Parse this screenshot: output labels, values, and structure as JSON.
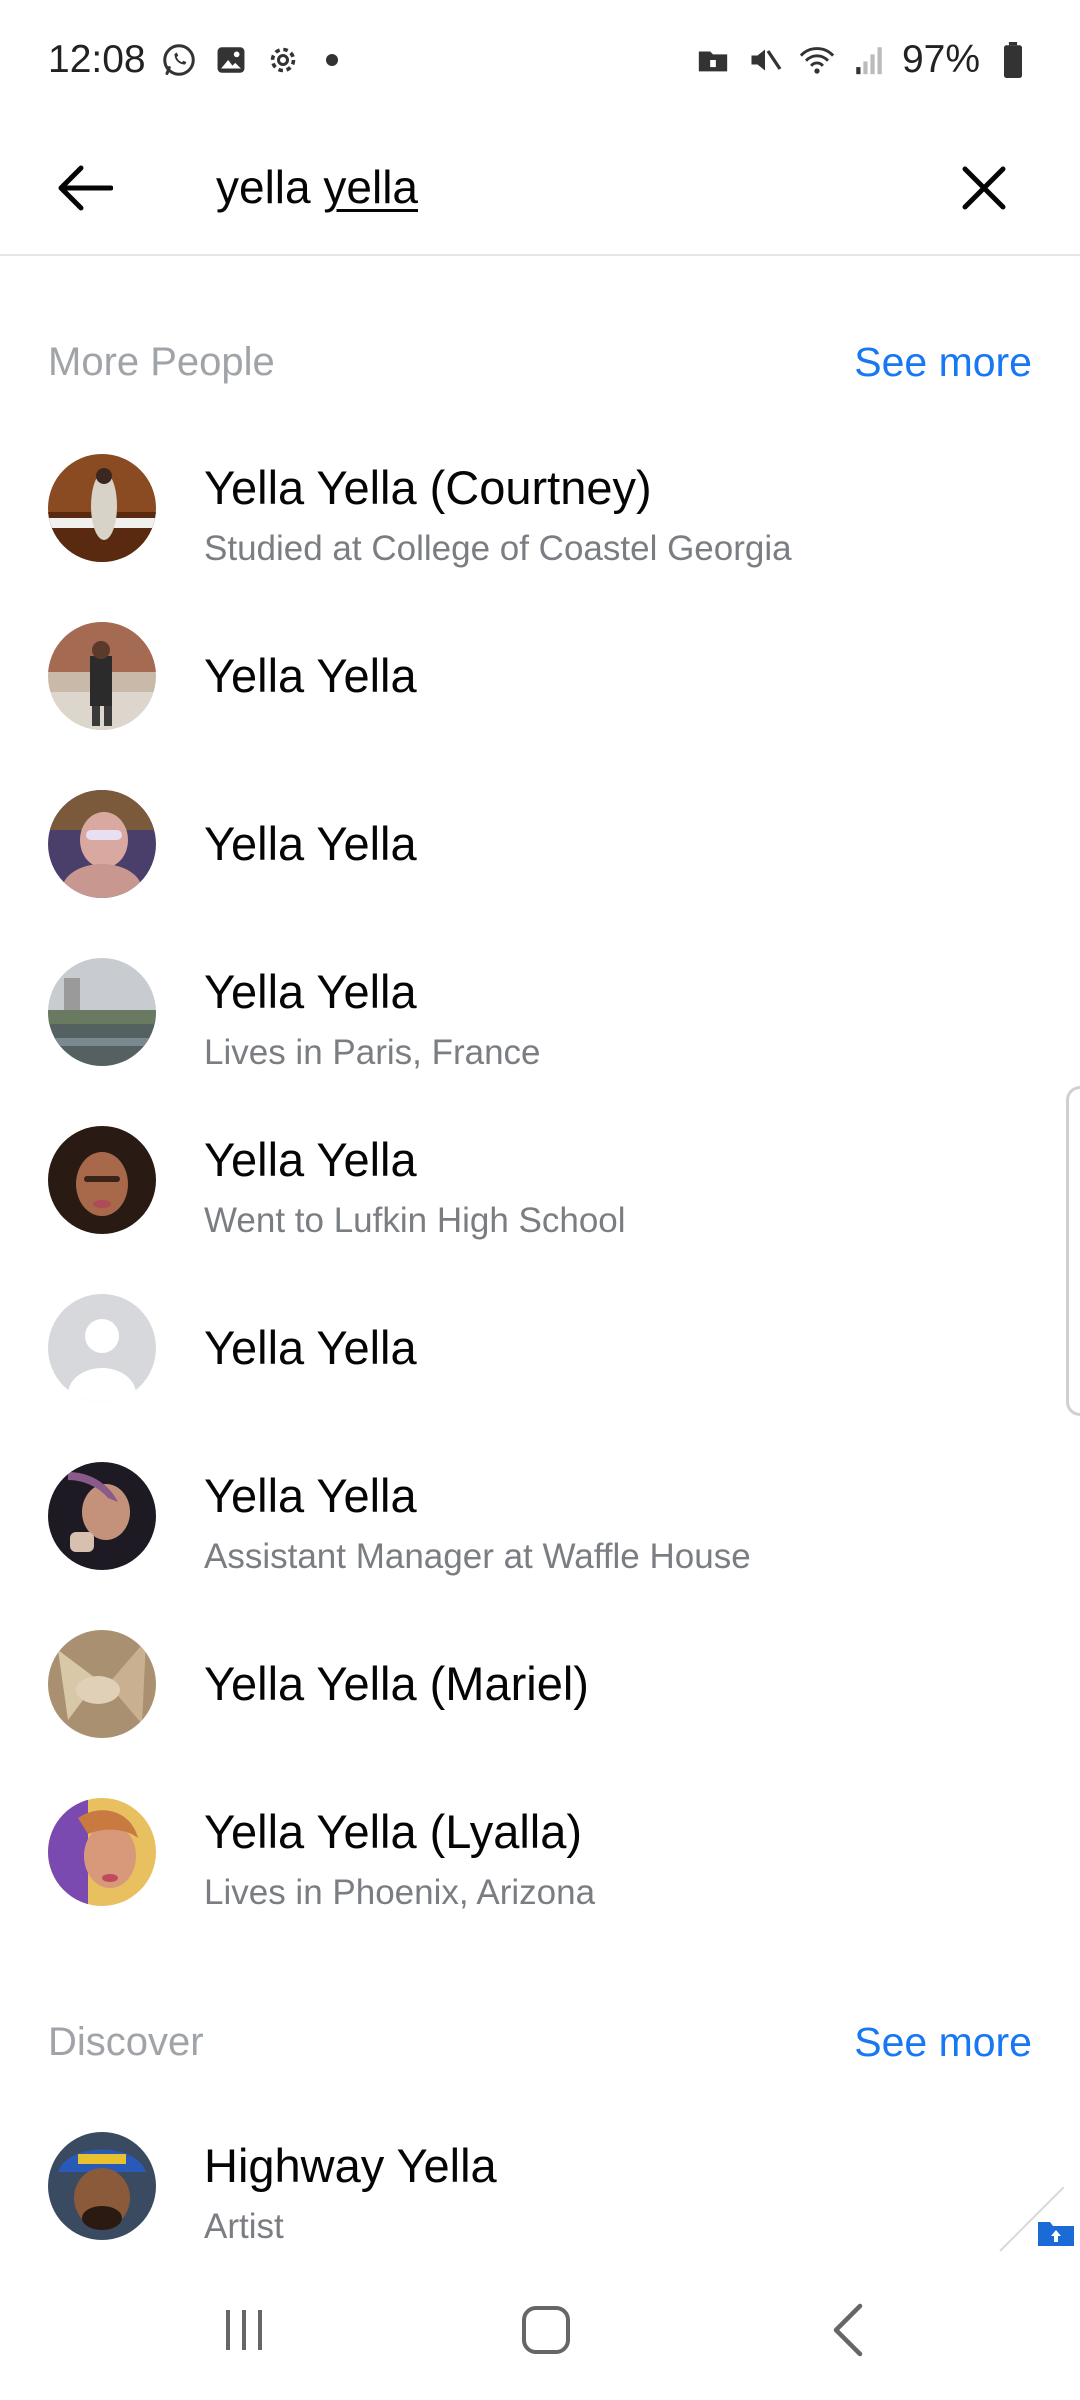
{
  "status_bar": {
    "time": "12:08",
    "battery": "97%",
    "icons_left": [
      "whatsapp-icon",
      "gallery-icon",
      "settings-icon",
      "dot-icon"
    ],
    "icons_right": [
      "vpn-lock-icon",
      "mute-icon",
      "wifi-icon",
      "signal-icon",
      "battery-icon"
    ]
  },
  "search": {
    "query_first": "yella",
    "query_second": "yella"
  },
  "sections": {
    "more_people": {
      "title": "More People",
      "see_more": "See more",
      "items": [
        {
          "name": "Yella Yella (Courtney)",
          "subtitle": "Studied at College of Coastel Georgia"
        },
        {
          "name": "Yella Yella",
          "subtitle": ""
        },
        {
          "name": "Yella Yella",
          "subtitle": ""
        },
        {
          "name": "Yella Yella",
          "subtitle": "Lives in Paris, France"
        },
        {
          "name": "Yella Yella",
          "subtitle": "Went to Lufkin High School"
        },
        {
          "name": "Yella Yella",
          "subtitle": ""
        },
        {
          "name": "Yella Yella",
          "subtitle": "Assistant Manager at Waffle House"
        },
        {
          "name": "Yella Yella (Mariel)",
          "subtitle": ""
        },
        {
          "name": "Yella Yella (Lyalla)",
          "subtitle": "Lives in Phoenix, Arizona"
        }
      ]
    },
    "discover": {
      "title": "Discover",
      "see_more": "See more",
      "items": [
        {
          "name": "Highway Yella",
          "subtitle": "Artist"
        }
      ]
    }
  },
  "colors": {
    "accent": "#1877f2",
    "section_title": "#a0a3a8",
    "subtitle": "#7a7d82"
  }
}
